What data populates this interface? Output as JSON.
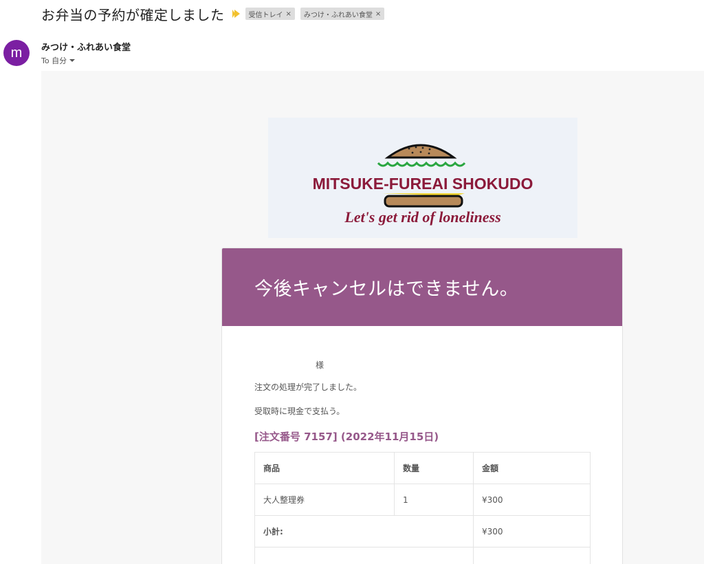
{
  "subject": "お弁当の予約が確定しました",
  "labels": [
    {
      "text": "受信トレイ",
      "remove": "×"
    },
    {
      "text": "みつけ・ふれあい食堂",
      "remove": "×"
    }
  ],
  "sender": {
    "avatar_letter": "m",
    "name": "みつけ・ふれあい食堂",
    "to_label": "To 自分"
  },
  "banner": {
    "brand": "MITSUKE-FUREAI SHOKUDO",
    "tagline": "Let's get rid of loneliness"
  },
  "card": {
    "title": "今後キャンセルはできません。",
    "greeting": "様",
    "processed": "注文の処理が完了しました。",
    "payment": "受取時に現金で支払う。",
    "order_heading": "[注文番号 7157] (2022年11月15日)",
    "table": {
      "headers": [
        "商品",
        "数量",
        "金額"
      ],
      "rows": [
        {
          "product": "大人整理券",
          "qty": "1",
          "price": "¥300"
        }
      ],
      "subtotal_label": "小計:",
      "subtotal_value": "¥300"
    }
  },
  "colors": {
    "accent": "#96588a",
    "avatar": "#7b1fa2",
    "brand_text": "#8b1a3a",
    "lettuce": "#2aa640",
    "bun": "#b88a5a"
  }
}
